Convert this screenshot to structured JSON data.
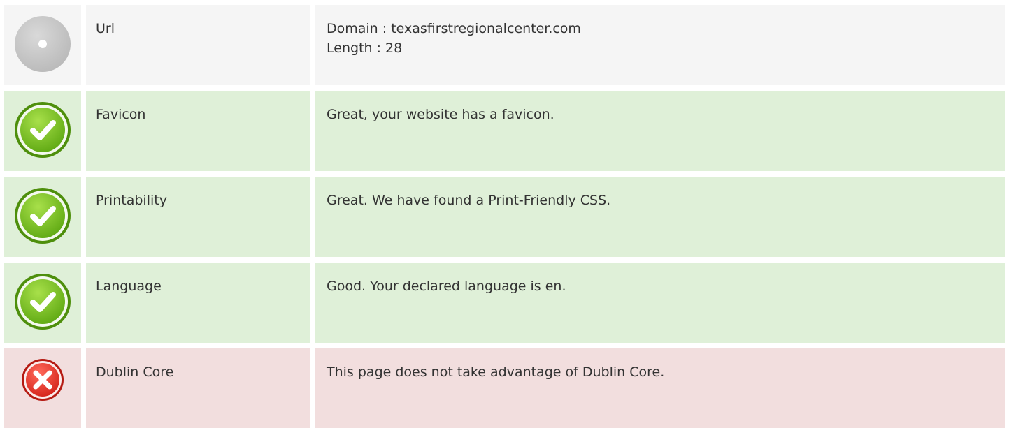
{
  "colors": {
    "neutral_bg": "#f5f5f5",
    "ok_bg": "#dff0d8",
    "bad_bg": "#f2dede",
    "ok_icon": "#7cc21c",
    "bad_icon": "#e53935",
    "neutral_icon": "#c8c8c8"
  },
  "rows": [
    {
      "status": "neutral",
      "icon": "neutral-circle-icon",
      "name": "Url",
      "lines": [
        "Domain : texasfirstregionalcenter.com",
        "Length : 28"
      ]
    },
    {
      "status": "ok",
      "icon": "checkmark-icon",
      "name": "Favicon",
      "lines": [
        "Great, your website has a favicon."
      ]
    },
    {
      "status": "ok",
      "icon": "checkmark-icon",
      "name": "Printability",
      "lines": [
        "Great. We have found a Print-Friendly CSS."
      ]
    },
    {
      "status": "ok",
      "icon": "checkmark-icon",
      "name": "Language",
      "lines": [
        "Good. Your declared language is en."
      ]
    },
    {
      "status": "bad",
      "icon": "cross-icon",
      "name": "Dublin Core",
      "lines": [
        "This page does not take advantage of Dublin Core."
      ]
    }
  ]
}
